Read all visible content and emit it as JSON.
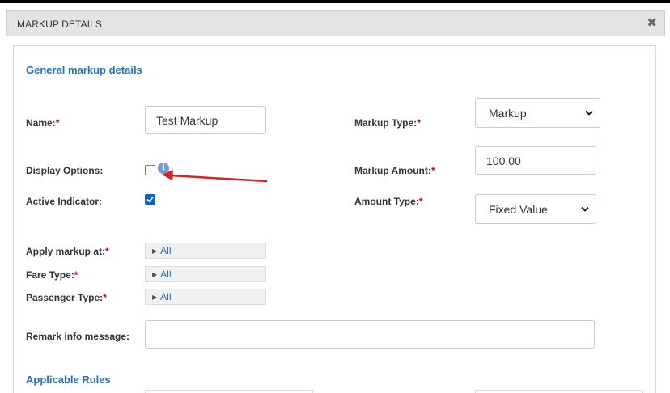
{
  "header": {
    "title": "MARKUP DETAILS",
    "close_glyph": "✖"
  },
  "sections": {
    "general": "General markup details",
    "rules": "Applicable Rules"
  },
  "required_marker": "*",
  "fields": {
    "name": {
      "label": "Name:",
      "value": "Test Markup"
    },
    "markup_type": {
      "label": "Markup Type:",
      "selected": "Markup"
    },
    "display_options": {
      "label": "Display Options:",
      "checked": false,
      "info_icon": "info-icon"
    },
    "markup_amount": {
      "label": "Markup Amount:",
      "value": "100.00"
    },
    "active_indicator": {
      "label": "Active Indicator:",
      "checked": true
    },
    "amount_type": {
      "label": "Amount Type:",
      "selected": "Fixed Value"
    },
    "apply_markup_at": {
      "label": "Apply markup at:",
      "value": "All"
    },
    "fare_type": {
      "label": "Fare Type:",
      "value": "All"
    },
    "passenger_type": {
      "label": "Passenger Type:",
      "value": "All"
    },
    "remark_info": {
      "label": "Remark info message:",
      "value": ""
    }
  },
  "colors": {
    "accent": "#1e73be",
    "required": "#d0021b",
    "arrow": "#e02020",
    "checkbox": "#0a63d6"
  }
}
